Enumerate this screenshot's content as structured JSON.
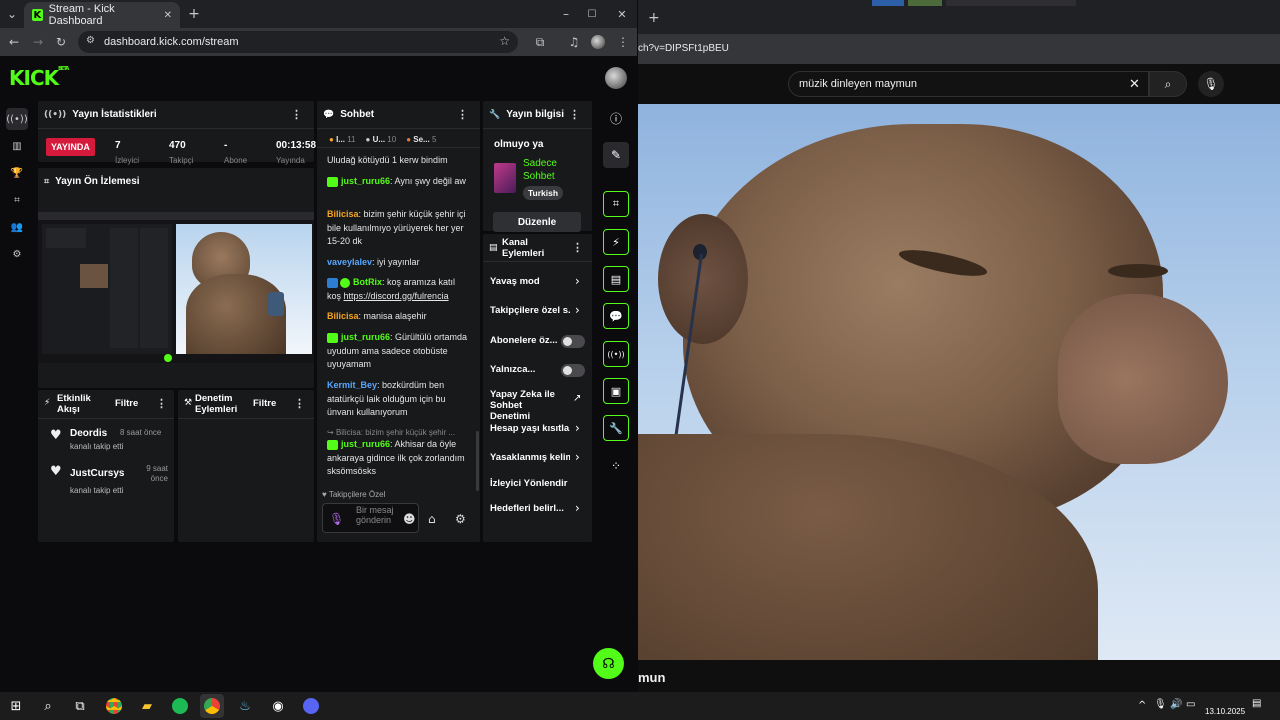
{
  "browser": {
    "tab_title": "Stream - Kick Dashboard",
    "url": "dashboard.kick.com/stream"
  },
  "kick": {
    "logo": "KICK",
    "logo_sup": "BETA",
    "accent": "#53fc18"
  },
  "stats": {
    "title": "Yayın İstatistikleri",
    "live_label": "YAYINDA",
    "viewers": "7",
    "followers": "470",
    "subs": "-",
    "duration": "00:13:58",
    "labels": [
      "İzleyici",
      "Takipçi",
      "Abone",
      "Yayında"
    ]
  },
  "preview": {
    "title": "Yayın Ön İzlemesi"
  },
  "activity": {
    "title": "Etkinlik Akışı",
    "filter": "Filtre",
    "items": [
      {
        "user": "Deordis",
        "time": "8 saat önce",
        "text": "kanalı takip etti"
      },
      {
        "user": "JustCursys",
        "time": "9 saat önce",
        "text": "kanalı takip etti"
      }
    ]
  },
  "moderation": {
    "title": "Denetim Eylemleri",
    "filter": "Filtre"
  },
  "chat": {
    "title": "Sohbet",
    "top": [
      {
        "name": "I...",
        "count": "11"
      },
      {
        "name": "U...",
        "count": "10"
      },
      {
        "name": "Se...",
        "count": "5"
      }
    ],
    "messages": [
      {
        "user": "",
        "text": "Uludağ kötüydü 1 kerw bindim"
      },
      {
        "user": "just_ruru66",
        "text": ": Aynı şwy değil aw"
      },
      {
        "user": "Bilicisa",
        "text": ": bizim şehir küçük şehir içi bile kullanılmıyo yürüyerek her yer 15-20 dk"
      },
      {
        "user": "vaveylalev",
        "text": ": iyi yayınlar"
      },
      {
        "user": "BotRix",
        "text": ": koş aramıza katıl koş ",
        "link": "https://discord.gg/fulrencia"
      },
      {
        "user": "Bilicisa",
        "text": ": manisa alaşehir"
      },
      {
        "user": "just_ruru66",
        "text": ": Gürültülü ortamda uyudum ama sadece otobüste uyuyamam"
      },
      {
        "user": "Kermit_Bey",
        "text": ": bozkürdüm ben atatürkçü laik olduğum için bu ünvanı kullanıyorum"
      },
      {
        "user": "just_ruru66",
        "text": ": Akhisar da öyle ankaraya gidince ilk çok zorlandım sksömsösks",
        "reply": "Bilicisa: bizim şehir küçük şehir ..."
      }
    ],
    "followers_only": "Takipçilere Özel",
    "placeholder": "Bir mesaj gönderin"
  },
  "stream_info": {
    "title": "Yayın bilgisi",
    "stream_title": "olmuyo ya",
    "category": "Sadece Sohbet",
    "language": "Turkish",
    "edit": "Düzenle"
  },
  "channel_actions": {
    "title": "Kanal Eylemleri",
    "items": [
      {
        "label": "Yavaş mod",
        "type": "chevron"
      },
      {
        "label": "Takipçilere özel s...",
        "type": "chevron"
      },
      {
        "label": "Abonelere öz...",
        "type": "toggle"
      },
      {
        "label": "Yalnızca...",
        "type": "toggle"
      },
      {
        "label": "Yapay Zeka ile Sohbet Denetimi",
        "type": "external"
      },
      {
        "label": "Hesap yaşı kısıtla...",
        "type": "chevron"
      },
      {
        "label": "Yasaklanmış kelim...",
        "type": "chevron"
      },
      {
        "label": "İzleyici Yönlendir",
        "type": "none"
      },
      {
        "label": "Hedefleri belirl...",
        "type": "chevron"
      }
    ]
  },
  "youtube": {
    "url_fragment": "ch?v=DIPSFt1pBEU",
    "search_value": "müzik dinleyen maymun",
    "title_fragment": "mun"
  },
  "taskbar": {
    "time": "",
    "date": "13.10.2025"
  }
}
